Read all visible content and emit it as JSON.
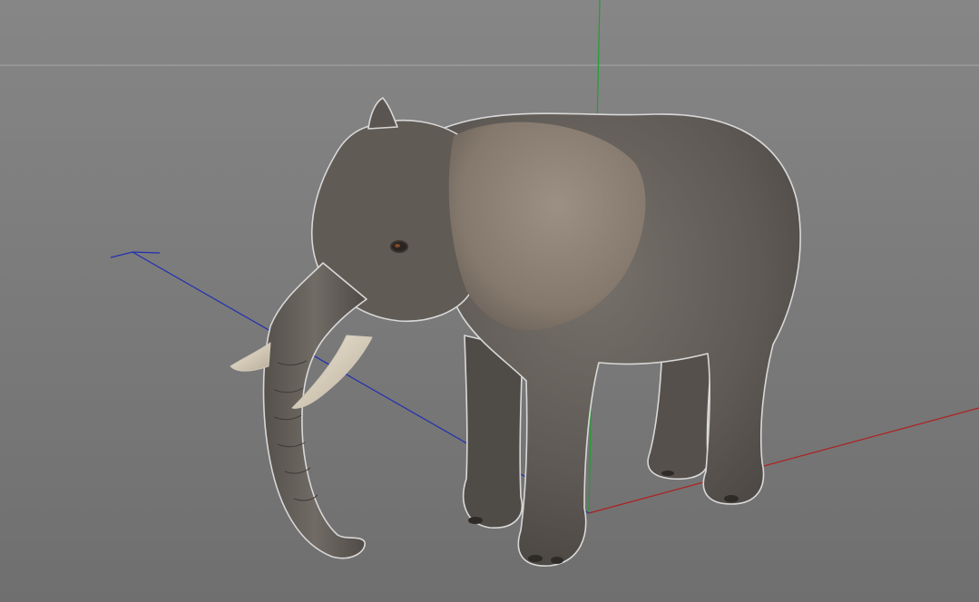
{
  "viewport": {
    "background_top": "#868686",
    "background_bottom": "#6f6f6f",
    "horizon_color": "#a6a6a6"
  },
  "axes": {
    "x_color": "#b02020",
    "y_color": "#20a030",
    "z_color": "#2030b0"
  },
  "model": {
    "subject": "elephant",
    "skin_color": "#5e5954",
    "ear_color": "#8a7e72",
    "tusk_color": "#ddd3c2",
    "selection_outline": "#d8d8d8"
  }
}
